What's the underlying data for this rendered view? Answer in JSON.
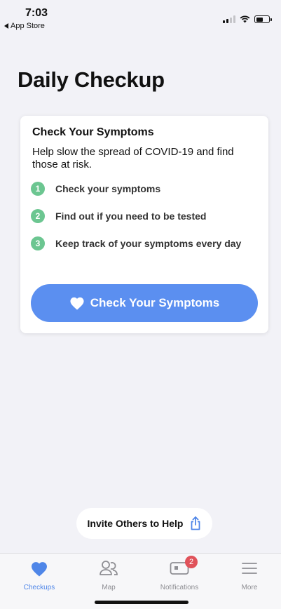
{
  "status_bar": {
    "time": "7:03",
    "back_label": "App Store"
  },
  "page": {
    "title": "Daily Checkup"
  },
  "card": {
    "title": "Check Your Symptoms",
    "description": "Help slow the spread of COVID-19 and find those at risk.",
    "steps": [
      {
        "number": "1",
        "label": "Check your symptoms"
      },
      {
        "number": "2",
        "label": "Find out if you need to be tested"
      },
      {
        "number": "3",
        "label": "Keep track of your symptoms every day"
      }
    ],
    "button_label": "Check Your Symptoms"
  },
  "invite": {
    "label": "Invite Others to Help"
  },
  "tabbar": {
    "tabs": [
      {
        "label": "Checkups",
        "icon": "heart-icon",
        "active": true
      },
      {
        "label": "Map",
        "icon": "people-icon",
        "active": false
      },
      {
        "label": "Notifications",
        "icon": "message-icon",
        "active": false,
        "badge": "2"
      },
      {
        "label": "More",
        "icon": "menu-icon",
        "active": false
      }
    ]
  },
  "colors": {
    "accent": "#5b8ff0",
    "step": "#6cc691",
    "badge": "#e0525a",
    "background": "#f2f2f7"
  }
}
